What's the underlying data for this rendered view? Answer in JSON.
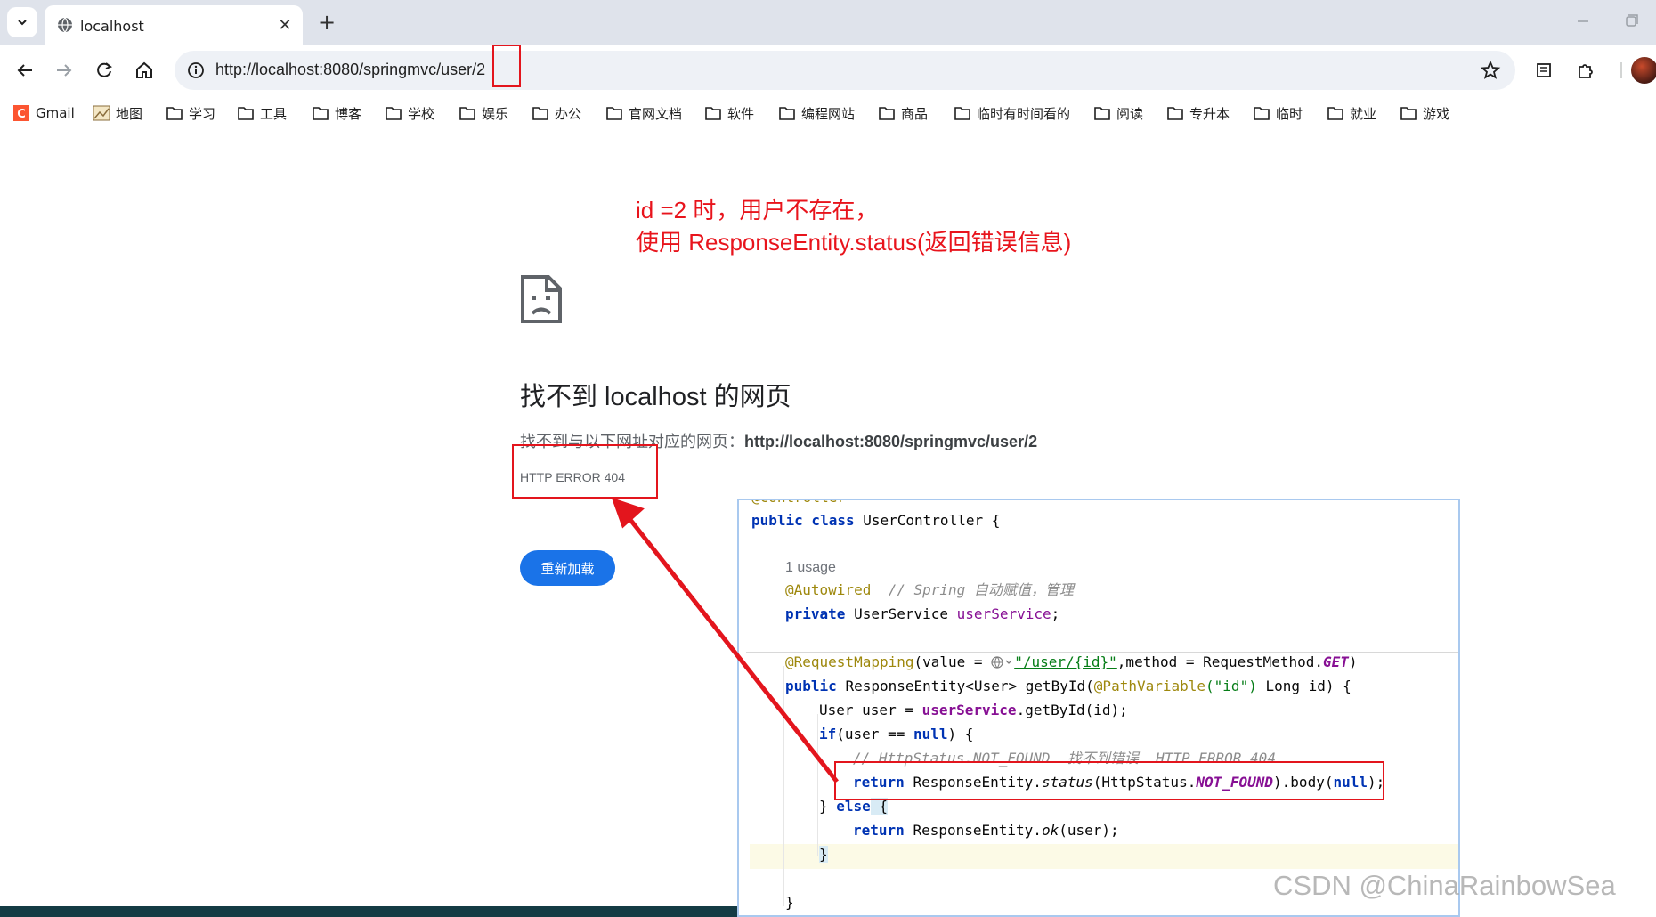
{
  "browser": {
    "tab_title": "localhost",
    "url": "http://localhost:8080/springmvc/user/2",
    "bookmarks": [
      "Gmail",
      "地图",
      "学习",
      "工具",
      "博客",
      "学校",
      "娱乐",
      "办公",
      "官网文档",
      "软件",
      "编程网站",
      "商品",
      "临时有时间看的",
      "阅读",
      "专升本",
      "临时",
      "就业",
      "游戏"
    ]
  },
  "annotation": {
    "line1": "id =2 时，用户不存在，",
    "line2": "使用 ResponseEntity.status(返回错误信息)"
  },
  "error_page": {
    "title": "找不到 localhost 的网页",
    "desc_prefix": "找不到与以下网址对应的网页：",
    "desc_url": "http://localhost:8080/springmvc/user/2",
    "code": "HTTP ERROR 404",
    "reload_label": "重新加载"
  },
  "code": {
    "line_top_clip": "@Controller",
    "class_decl_kw": "public class ",
    "class_name": "UserController {",
    "usage": "1 usage",
    "autowired": "@Autowired",
    "autowired_comment": "// Spring 自动赋值，管理",
    "field_kw": "private ",
    "field_type": "UserService ",
    "field_name": "userService",
    "field_end": ";",
    "mapping_ann": "@RequestMapping",
    "mapping_args1": "(value = ",
    "mapping_path": "\"/user/{id}\"",
    "mapping_args2": ",method = RequestMethod.",
    "mapping_get": "GET",
    "mapping_end": ")",
    "method_kw": "public ",
    "method_sig1": "ResponseEntity<User> getById(",
    "pathvar": "@PathVariable",
    "pathvar_arg": "(\"id\")",
    "method_sig2": " Long id) {",
    "user_decl1": "User user = ",
    "user_decl2": "userService",
    "user_decl3": ".getById(id);",
    "if_kw": "if",
    "if_cond1": "(user == ",
    "null_kw": "null",
    "if_cond2": ") {",
    "comment_404": "// HttpStatus.NOT_FOUND  找不到错误  HTTP ERROR 404",
    "return_kw": "return ",
    "ret1": "ResponseEntity.",
    "ret_status": "status",
    "ret2": "(HttpStatus.",
    "ret_notfound": "NOT_FOUND",
    "ret3": ").body(",
    "ret_null": "null",
    "ret4": ");",
    "else_close": "} ",
    "else_kw": "else",
    "else_open": " {",
    "ret_ok1": "ResponseEntity.",
    "ret_ok": "ok",
    "ret_ok2": "(user);",
    "close_brace_inner": "}",
    "close_brace": "}"
  },
  "watermark": "CSDN @ChinaRainbowSea",
  "colors": {
    "annotation": "#e8141c",
    "highlight_box": "#e3151d",
    "reload_button": "#1a73e8"
  }
}
